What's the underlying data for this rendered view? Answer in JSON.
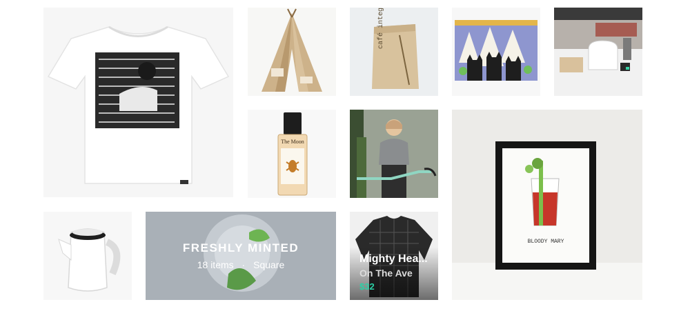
{
  "collection": {
    "title": "FRESHLY MINTED",
    "items_count": "18 items",
    "separator": "·",
    "source": "Square"
  },
  "featured_item": {
    "title": "Mighty Hea...",
    "seller": "On The Ave",
    "price": "$32",
    "price_color": "#2bd1a6"
  },
  "products": {
    "tshirt": {
      "icon": "tshirt-image"
    },
    "teepee": {
      "icon": "teepee-image"
    },
    "coffee_bag": {
      "icon": "coffee-bag-image",
      "label": "café integral"
    },
    "cats_art": {
      "icon": "cats-art-image"
    },
    "coffee_kitchen": {
      "icon": "coffee-kitchen-image"
    },
    "perfume": {
      "icon": "perfume-image",
      "label": "The Moon"
    },
    "bike_woman": {
      "icon": "bike-woman-image"
    },
    "framed_print": {
      "icon": "framed-print-image",
      "label": "BLOODY MARY"
    },
    "teapot": {
      "icon": "teapot-image"
    },
    "flannel": {
      "icon": "flannel-shirt-image"
    }
  }
}
